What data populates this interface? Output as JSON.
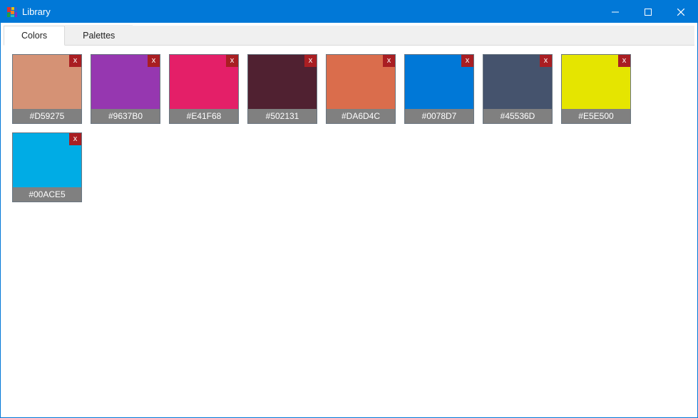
{
  "window": {
    "title": "Library"
  },
  "tabs": {
    "colors": "Colors",
    "palettes": "Palettes",
    "activeIndex": 0
  },
  "closeGlyph": "x",
  "colors": [
    {
      "hex": "#D59275",
      "value": "#d59275"
    },
    {
      "hex": "#9637B0",
      "value": "#9637b0"
    },
    {
      "hex": "#E41F68",
      "value": "#e41f68"
    },
    {
      "hex": "#502131",
      "value": "#502131"
    },
    {
      "hex": "#DA6D4C",
      "value": "#da6d4c"
    },
    {
      "hex": "#0078D7",
      "value": "#0078d7"
    },
    {
      "hex": "#45536D",
      "value": "#45536d"
    },
    {
      "hex": "#E5E500",
      "value": "#e5e500"
    },
    {
      "hex": "#00ACE5",
      "value": "#00ace5"
    }
  ]
}
